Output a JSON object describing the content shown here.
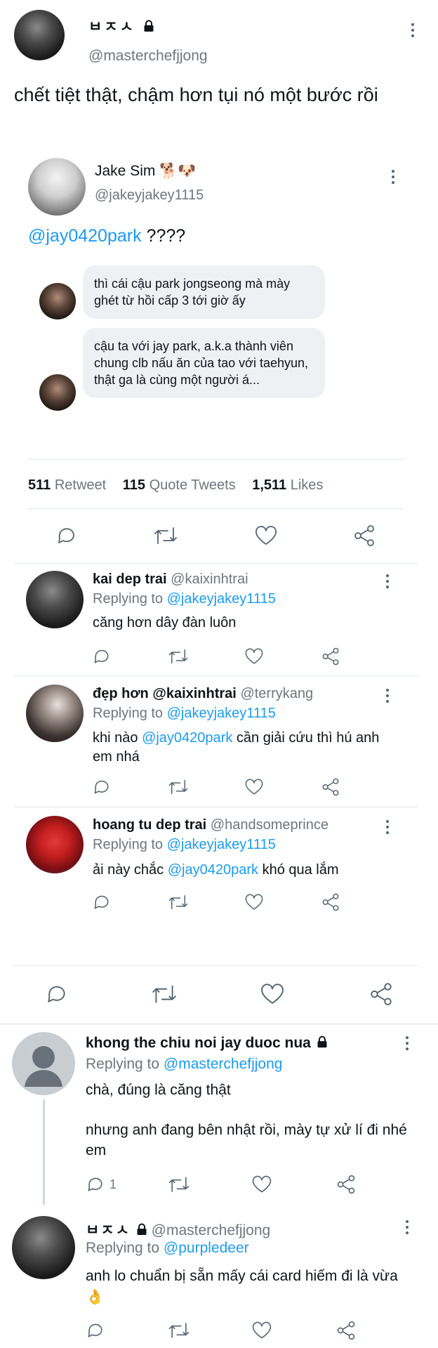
{
  "main_tweet": {
    "display_name": "ㅂㅈㅅ",
    "handle": "@masterchefjjong",
    "text": "chết tiệt thật, chậm hơn tụi nó một bước rồi",
    "icon": "lock-icon"
  },
  "quoted": {
    "display_name": "Jake Sim",
    "emoji": "🐕🐶",
    "handle": "@jakeyjakey1115",
    "mention": "@jay0420park",
    "text_suffix": " ????",
    "dm_messages": [
      "thì cái cậu park jongseong mà mày ghét từ hồi cấp 3 tới giờ ấy",
      "cậu ta với jay park, a.k.a thành viên chung clb nấu ăn của tao với taehyun, thật ga là cùng một người á..."
    ],
    "stats": {
      "retweets": "511",
      "retweets_label": "Retweet",
      "quotes": "115",
      "quotes_label": "Quote Tweets",
      "likes": "1,511",
      "likes_label": "Likes"
    },
    "replies": [
      {
        "name": "kai dep trai",
        "handle": "@kaixinhtrai",
        "replying_prefix": "Replying to",
        "replying_to": "@jakeyjakey1115",
        "text_before": "căng hơn dây đàn luôn",
        "mention": "",
        "text_after": ""
      },
      {
        "name": "đẹp hơn @kaixinhtrai",
        "handle": "@terrykang",
        "replying_prefix": "Replying to",
        "replying_to": "@jakeyjakey1115",
        "text_before": "khi nào ",
        "mention": "@jay0420park",
        "text_after": " cần giải cứu thì hú anh em nhá"
      },
      {
        "name": "hoang tu dep trai",
        "handle": "@handsomeprince",
        "replying_prefix": "Replying to",
        "replying_to": "@jakeyjakey1115",
        "text_before": "ải này chắc ",
        "mention": "@jay0420park",
        "text_after": " khó qua lắm"
      }
    ]
  },
  "thread_replies": [
    {
      "name": "khong the chiu noi jay duoc nua",
      "handle": "",
      "replying_prefix": "Replying to",
      "replying_to": "@masterchefjjong",
      "line1": "chà, đúng là căng thật",
      "line2": "nhưng anh đang bên nhật rồi, mày tự xử lí đi nhé em",
      "reply_count": "1"
    },
    {
      "name": "ㅂㅈㅅ",
      "handle": "@masterchefjjong",
      "replying_prefix": "Replying to",
      "replying_to": "@purpledeer",
      "line1": "anh lo chuẩn bị sẵn mấy cái card hiếm đi là vừa",
      "emoji": "👌",
      "reply_count": ""
    }
  ],
  "colors": {
    "link": "#1d9bf0",
    "text": "#0f1419",
    "secondary": "#6e767d",
    "divider": "#e1e6ea",
    "bubble": "#eef1f4"
  }
}
